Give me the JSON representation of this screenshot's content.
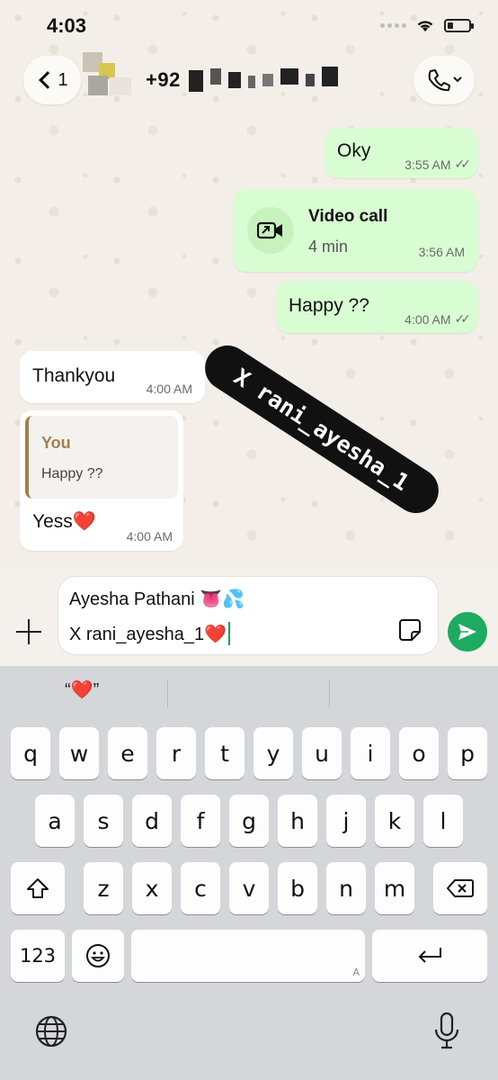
{
  "status_bar": {
    "time": "4:03"
  },
  "header": {
    "back_count": "1",
    "contact_name": "+92"
  },
  "messages": [
    {
      "direction": "out",
      "text": "Oky",
      "time": "3:55 AM",
      "ticks": "✓✓"
    },
    {
      "direction": "out",
      "type": "video_call",
      "title": "Video call",
      "duration": "4 min",
      "time": "3:56 AM"
    },
    {
      "direction": "out",
      "text": "Happy ??",
      "time": "4:00 AM",
      "ticks": "✓✓"
    },
    {
      "direction": "in",
      "text": "Thankyou",
      "time": "4:00 AM"
    },
    {
      "direction": "in",
      "quote_name": "You",
      "quote_text": "Happy ??",
      "text": "Yess❤️",
      "time": "4:00 AM"
    }
  ],
  "sticker": {
    "text": "X rani_ayesha_1"
  },
  "composer": {
    "line1": "Ayesha Pathani 👅💦",
    "line2": "X rani_ayesha_1❤️"
  },
  "keyboard": {
    "suggestions": [
      "“❤️”",
      "",
      ""
    ],
    "row1": [
      "q",
      "w",
      "e",
      "r",
      "t",
      "y",
      "u",
      "i",
      "o",
      "p"
    ],
    "row2": [
      "a",
      "s",
      "d",
      "f",
      "g",
      "h",
      "j",
      "k",
      "l"
    ],
    "row3": [
      "z",
      "x",
      "c",
      "v",
      "b",
      "n",
      "m"
    ],
    "numbers_key": "123",
    "space_hint": "A"
  },
  "colors": {
    "outgoing": "#d9fdd3",
    "incoming": "#ffffff",
    "send": "#1daa61",
    "quote_accent": "#a37f4c"
  }
}
